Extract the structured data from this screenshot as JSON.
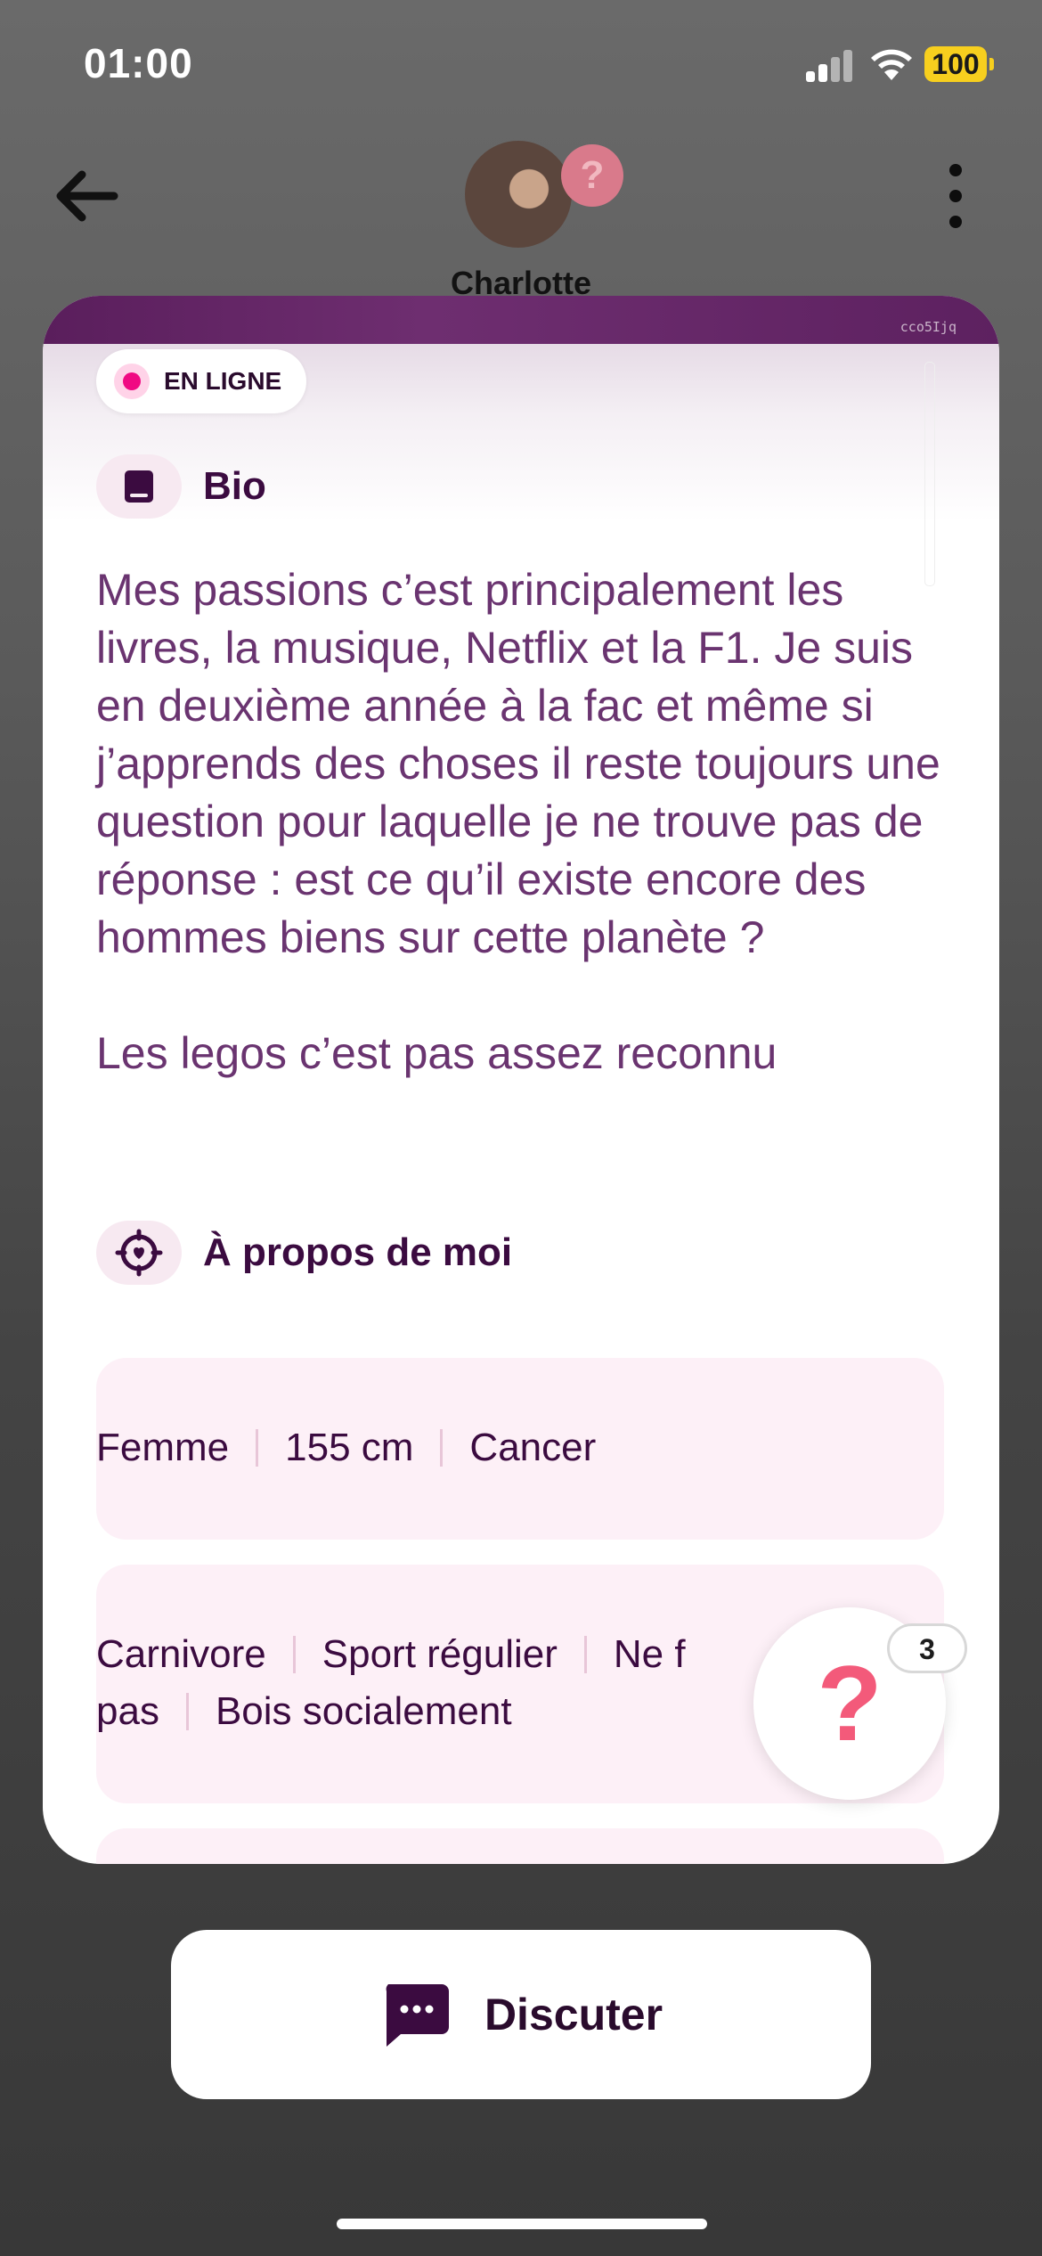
{
  "status_bar": {
    "time": "01:00",
    "battery": "100"
  },
  "header": {
    "name": "Charlotte",
    "avatar_badge": "?"
  },
  "card": {
    "watermark": "cco5Ijq",
    "online_label": "EN LIGNE",
    "bio_section": {
      "title": "Bio",
      "text": "Mes passions c’est principalement les livres, la musique, Netflix et la F1. Je suis en deuxième année à la fac et même si j’apprends des choses il reste toujours une question pour laquelle je ne trouve pas de réponse : est ce qu’il existe encore des hommes biens sur cette planète ?\n\nLes legos c’est pas assez reconnu"
    },
    "about_section": {
      "title": "À propos de moi",
      "row1": [
        "Femme",
        "155 cm",
        "Cancer"
      ],
      "row2_line1": [
        "Carnivore",
        "Sport régulier",
        "Ne f"
      ],
      "row2_line2": [
        "pas",
        "Bois socialement"
      ]
    }
  },
  "help_bubble": {
    "symbol": "?",
    "count": "3"
  },
  "chat_button": {
    "label": "Discuter"
  },
  "colors": {
    "accent": "#3b0b40",
    "online_dot": "#f00a83",
    "chip_bg": "#fdf0f7",
    "help_q": "#f35a7a"
  },
  "icons": [
    "back-arrow-icon",
    "more-vertical-icon",
    "book-icon",
    "heart-target-icon",
    "question-icon",
    "chat-bubble-icon"
  ]
}
